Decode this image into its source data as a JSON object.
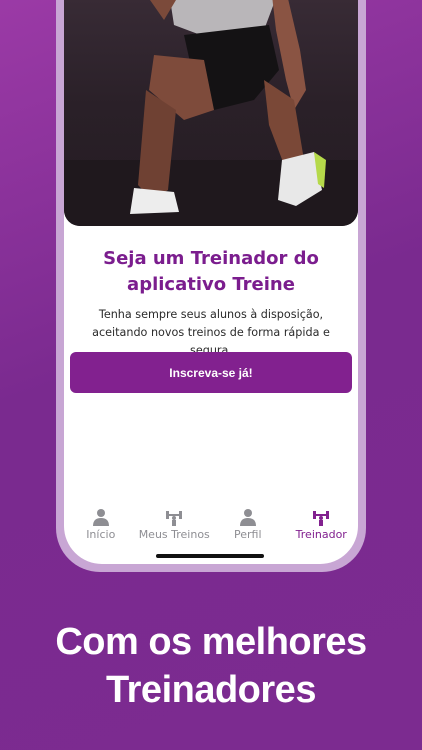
{
  "hero": {
    "image": "trainer-lunge-photo"
  },
  "content": {
    "title": "Seja um Treinador do aplicativo Treine",
    "description": "Tenha sempre seus alunos à disposição, aceitando novos treinos de forma rápida e segura.",
    "cta_label": "Inscreva-se já!"
  },
  "tabbar": {
    "items": [
      {
        "label": "Início",
        "icon": "person-icon"
      },
      {
        "label": "Meus Treinos",
        "icon": "dumbbell-icon"
      },
      {
        "label": "Perfil",
        "icon": "person-icon"
      },
      {
        "label": "Treinador",
        "icon": "dumbbell-icon",
        "active": true
      }
    ]
  },
  "caption": {
    "line1": "Com os melhores",
    "line2": "Treinadores"
  },
  "colors": {
    "accent": "#82218f",
    "title": "#7b1d8e",
    "background": "#8a2f9c"
  }
}
